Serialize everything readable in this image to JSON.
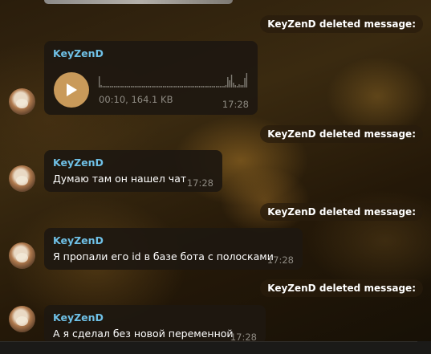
{
  "service_messages": [
    {
      "text": "KeyZenD deleted message:"
    },
    {
      "text": "KeyZenD deleted message:"
    },
    {
      "text": "KeyZenD deleted message:"
    },
    {
      "text": "KeyZenD deleted message:"
    }
  ],
  "messages": [
    {
      "sender": "KeyZenD",
      "type": "voice",
      "duration": "00:10",
      "size": "164.1 KB",
      "meta": "00:10, 164.1 KB",
      "time": "17:28"
    },
    {
      "sender": "KeyZenD",
      "type": "text",
      "text": "Думаю там он нашел чат",
      "time": "17:28"
    },
    {
      "sender": "KeyZenD",
      "type": "text",
      "text": "Я пропали его id в базе бота с полосками",
      "time": "17:28"
    },
    {
      "sender": "KeyZenD",
      "type": "text",
      "text": "А я сделал без новой переменной",
      "time": "17:28"
    }
  ],
  "icons": {
    "play": "play-icon",
    "avatar": "user-avatar"
  },
  "colors": {
    "sender": "#6fc0e6",
    "play_button": "#c99a5a",
    "bubble": "#1e1810",
    "service": "#281c0c"
  }
}
